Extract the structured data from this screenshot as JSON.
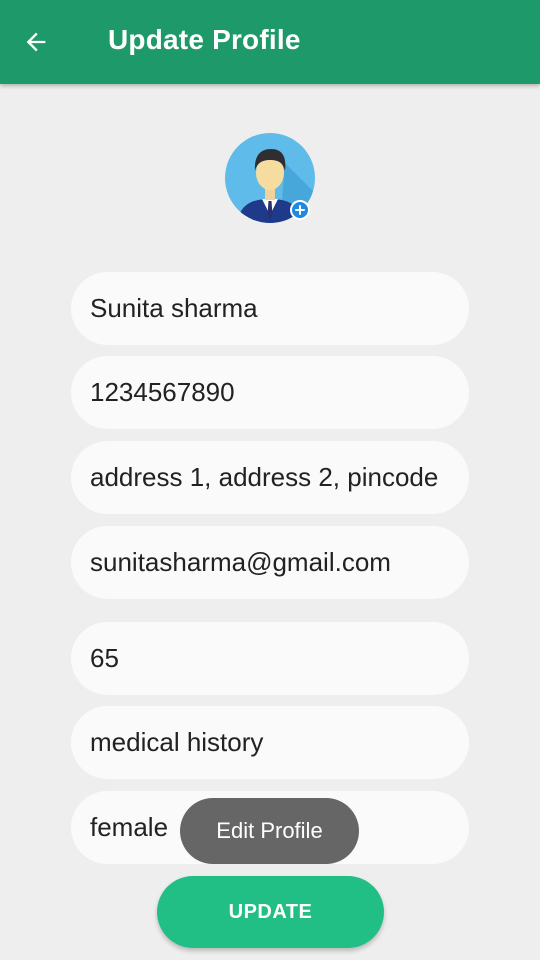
{
  "colors": {
    "appbar": "#1e9a6a",
    "background": "#eeeeee",
    "field": "#fafafa",
    "button": "#21bf86",
    "toast": "#666666"
  },
  "header": {
    "title": "Update Profile",
    "back_icon": "arrow-left-icon"
  },
  "avatar": {
    "icon": "user-avatar-icon",
    "badge_icon": "plus-icon"
  },
  "form": {
    "name": "Sunita sharma",
    "phone": "1234567890",
    "address": "address 1, address 2, pincode",
    "email": "sunitasharma@gmail.com",
    "age": "65",
    "medical_history": "medical history",
    "gender": "female"
  },
  "toast": {
    "text": "Edit Profile"
  },
  "update_button": {
    "label": "UPDATE"
  }
}
